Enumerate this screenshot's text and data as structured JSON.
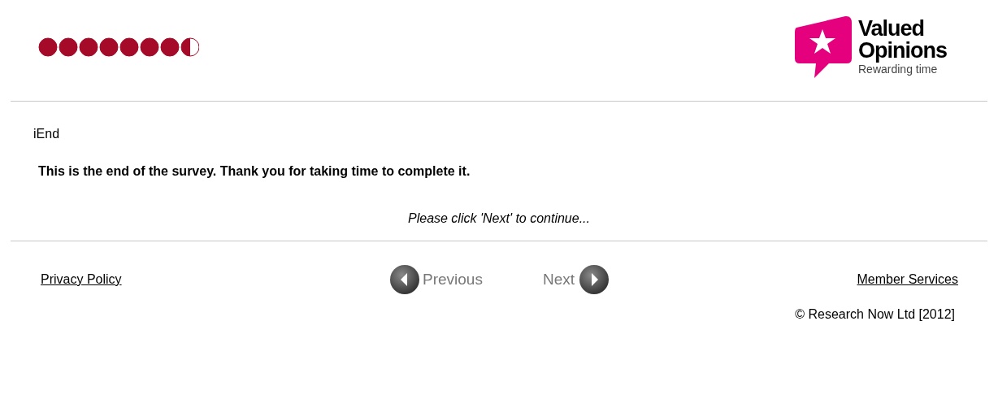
{
  "logo": {
    "title_line_1": "Valued",
    "title_line_2": "Opinions",
    "tagline": "Rewarding time"
  },
  "question_id": "iEnd",
  "message": "This is the end of the survey. Thank you for taking time to complete it.",
  "instruction": "Please click 'Next' to continue...",
  "footer": {
    "privacy_link": "Privacy Policy",
    "previous_button": "Previous",
    "next_button": "Next",
    "member_link": "Member Services",
    "copyright": "© Research Now Ltd [2012]"
  }
}
